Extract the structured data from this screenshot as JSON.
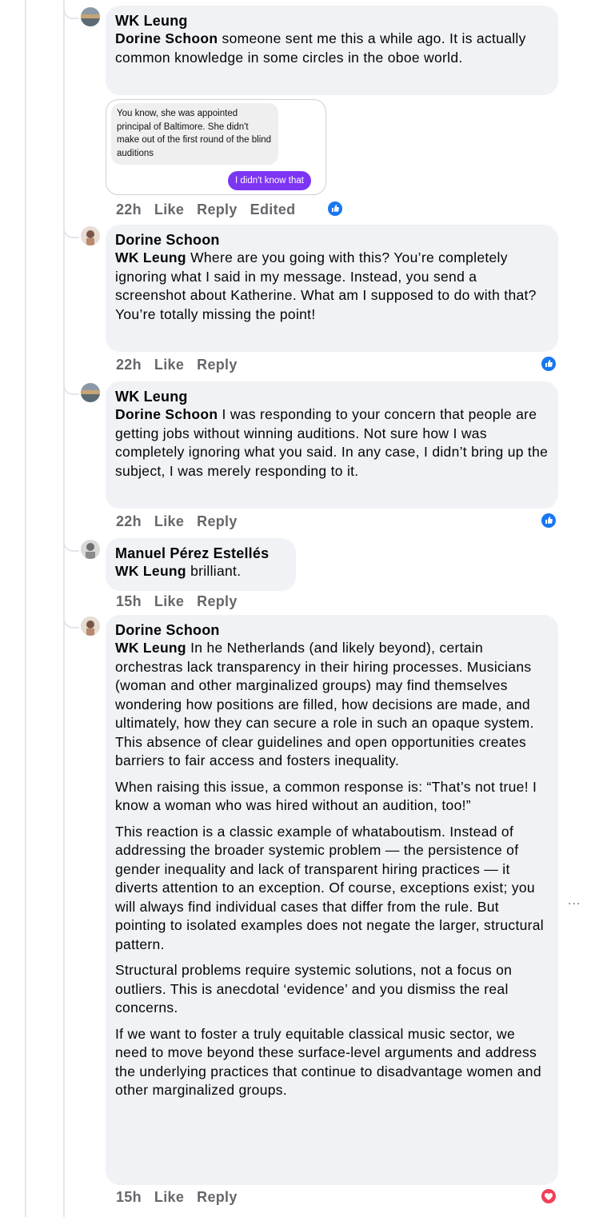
{
  "comments": [
    {
      "author": "WK Leung",
      "tag": "Dorine Schoon",
      "body": " someone sent me this a while ago. It is actually common knowledge in some circles in the oboe world.",
      "screenshot": {
        "message": "You know, she was appointed principal of Baltimore.  She didn't make out of the first round of the blind auditions",
        "reply": "I didn't know that"
      },
      "time": "22h",
      "like": "Like",
      "reply": "Reply",
      "edited": "Edited",
      "reaction": "like"
    },
    {
      "author": "Dorine Schoon",
      "tag": "WK Leung",
      "body": " Where are you going with this? You’re completely ignoring what I said in my message. Instead, you send a screenshot about Katherine. What am I supposed to do with that? You’re totally missing the point!",
      "time": "22h",
      "like": "Like",
      "reply": "Reply",
      "reaction": "like"
    },
    {
      "author": "WK Leung",
      "tag": "Dorine Schoon",
      "body": " I was responding to your concern that people are getting jobs without winning auditions. Not sure how I was completely ignoring what you said. In any case, I didn’t bring up the subject, I was merely responding to it.",
      "time": "22h",
      "like": "Like",
      "reply": "Reply",
      "reaction": "like"
    },
    {
      "author": "Manuel Pérez Estellés",
      "tag": "WK Leung",
      "body": " brilliant.",
      "time": "15h",
      "like": "Like",
      "reply": "Reply"
    },
    {
      "author": "Dorine Schoon",
      "tag": "WK Leung",
      "body": " In he Netherlands (and likely beyond), certain orchestras lack transparency in their hiring processes. Musicians (woman and other marginalized groups) may find themselves wondering how positions are filled, how decisions are made, and ultimately, how they can secure a role in such an opaque system. This absence of clear guidelines and open opportunities creates barriers to fair access and fosters inequality.",
      "paragraphs": [
        "When raising this issue, a common response is: “That’s not true! I know a woman who was hired without an audition, too!”",
        "This reaction is a classic example of whataboutism. Instead of addressing the broader systemic problem — the persistence of gender inequality and lack of transparent hiring practices — it diverts attention to an exception. Of course, exceptions exist; you will always find individual cases that differ from the rule. But pointing to isolated examples does not negate the larger, structural pattern.",
        "Structural problems require systemic solutions, not a focus on outliers. This is anecdotal ‘evidence’ and you dismiss the real concerns.",
        "If we want to foster a truly equitable classical music sector, we need to move beyond these surface-level arguments and address the underlying practices that continue to disadvantage women and other marginalized groups."
      ],
      "time": "15h",
      "like": "Like",
      "reply": "Reply",
      "reaction": "love"
    }
  ],
  "more_label": "...",
  "colors": {
    "bubble": "#f0f2f5",
    "meta": "#65676b",
    "like": "#1877f2",
    "love": "#f33e58",
    "messenger": "#7d35f4"
  }
}
